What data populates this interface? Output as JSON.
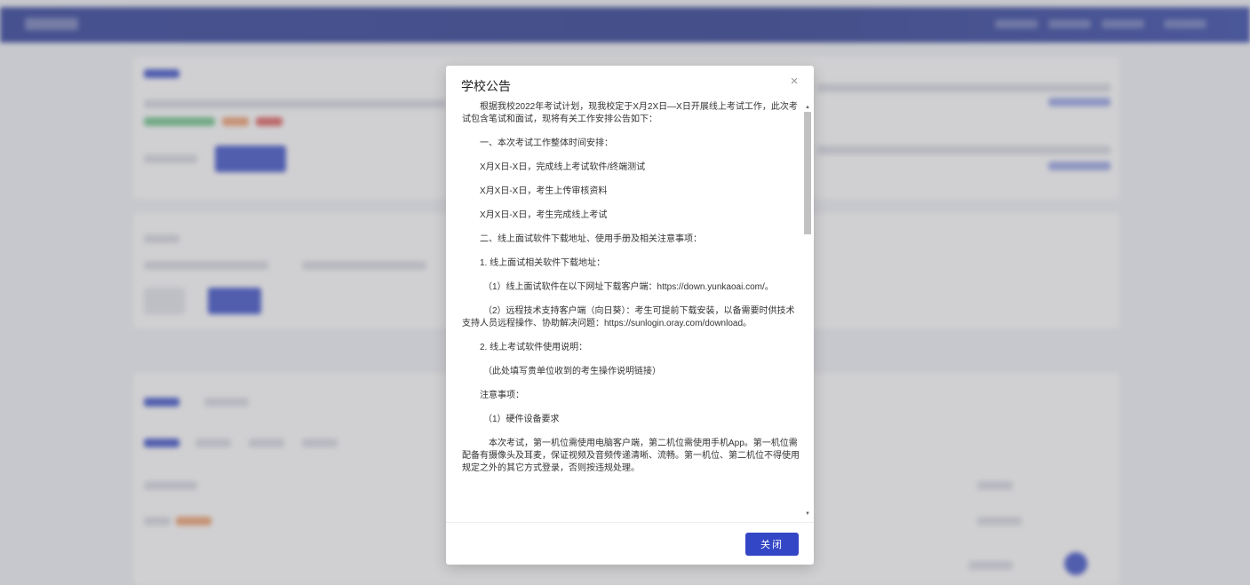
{
  "modal": {
    "title": "学校公告",
    "close_icon": "×",
    "paragraphs": [
      "根据我校2022年考试计划，现我校定于X月2X日—X日开展线上考试工作，此次考试包含笔试和面试，现将有关工作安排公告如下：",
      "一、本次考试工作整体时间安排：",
      "X月X日-X日，完成线上考试软件/终端测试",
      "X月X日-X日，考生上传审核资料",
      "X月X日-X日，考生完成线上考试",
      "二、线上面试软件下载地址、使用手册及相关注意事项：",
      "1. 线上面试相关软件下载地址：",
      "（1）线上面试软件在以下网址下载客户端：https://down.yunkaoai.com/。",
      "（2）远程技术支持客户端（向日葵）：考生可提前下载安装，以备需要时供技术支持人员远程操作、协助解决问题：https://sunlogin.oray.com/download。",
      "2. 线上考试软件使用说明：",
      "（此处填写贵单位收到的考生操作说明链接）",
      "注意事项：",
      "（1）硬件设备要求",
      "本次考试，第一机位需使用电脑客户端，第二机位需使用手机App。第一机位需配备有摄像头及耳麦，保证视频及音频传递清晰、流畅。第一机位、第二机位不得使用规定之外的其它方式登录，否则按违规处理。"
    ],
    "close_button_label": "关闭"
  },
  "colors": {
    "primary": "#3346c6",
    "topbar": "#2c3d9a"
  }
}
